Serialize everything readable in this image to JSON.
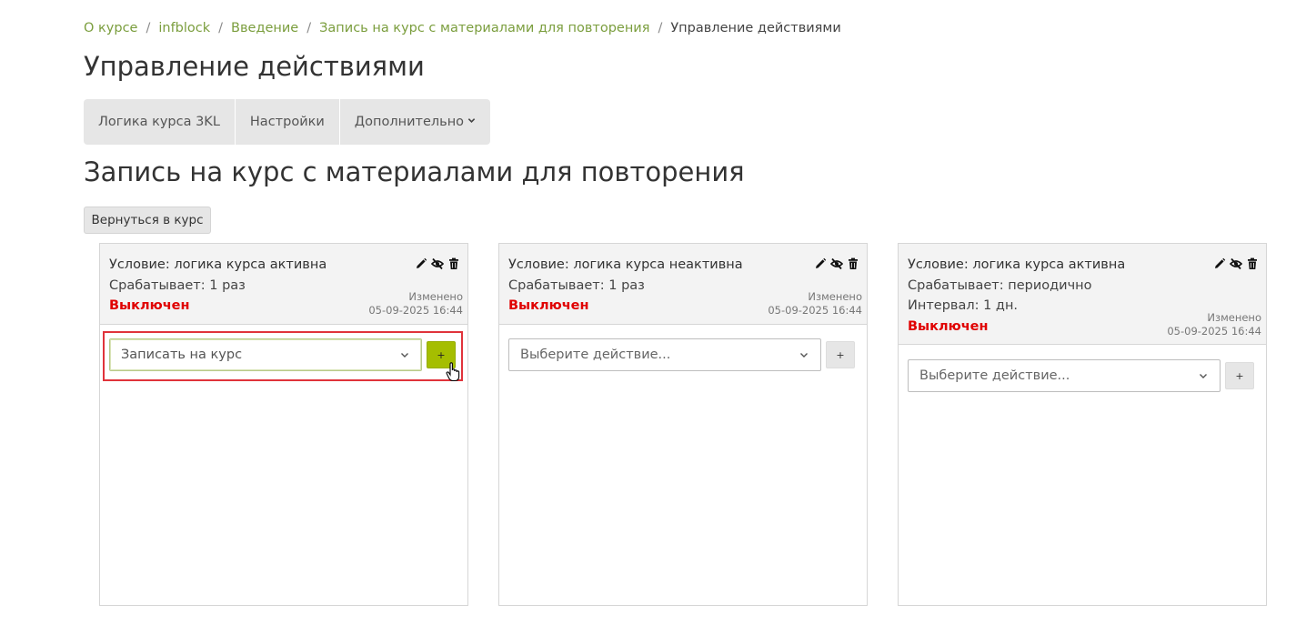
{
  "breadcrumb": {
    "items": [
      "О курсе",
      "infblock",
      "Введение",
      "Запись на курс с материалами для повторения"
    ],
    "current": "Управление действиями",
    "separator": "/"
  },
  "page_title": "Управление действиями",
  "tabs": [
    {
      "label": "Логика курса 3KL"
    },
    {
      "label": "Настройки"
    },
    {
      "label": "Дополнительно"
    }
  ],
  "section_title": "Запись на курс с материалами для повторения",
  "back_button": "Вернуться в курс",
  "cards": [
    {
      "condition": "Условие: логика курса активна",
      "triggers": "Срабатывает: 1 раз",
      "status": "Выключен",
      "modified_label": "Изменено",
      "modified_date": "05-09-2025 16:44",
      "action_select": "Записать на курс",
      "add_label": "+"
    },
    {
      "condition": "Условие: логика курса неактивна",
      "triggers": "Срабатывает: 1 раз",
      "status": "Выключен",
      "modified_label": "Изменено",
      "modified_date": "05-09-2025 16:44",
      "action_select": "Выберите действие...",
      "add_label": "+"
    },
    {
      "condition": "Условие: логика курса активна",
      "triggers": "Срабатывает: периодично",
      "interval": "Интервал: 1 дн.",
      "status": "Выключен",
      "modified_label": "Изменено",
      "modified_date": "05-09-2025 16:44",
      "action_select": "Выберите действие...",
      "add_label": "+"
    }
  ],
  "colors": {
    "link": "#7b9e3e",
    "status_off": "#e00000",
    "add_active": "#a5be00",
    "highlight": "#e0333b"
  },
  "icons": [
    "pencil-icon",
    "eye-slash-icon",
    "trash-icon",
    "chevron-down-icon",
    "pointer-cursor-icon"
  ]
}
